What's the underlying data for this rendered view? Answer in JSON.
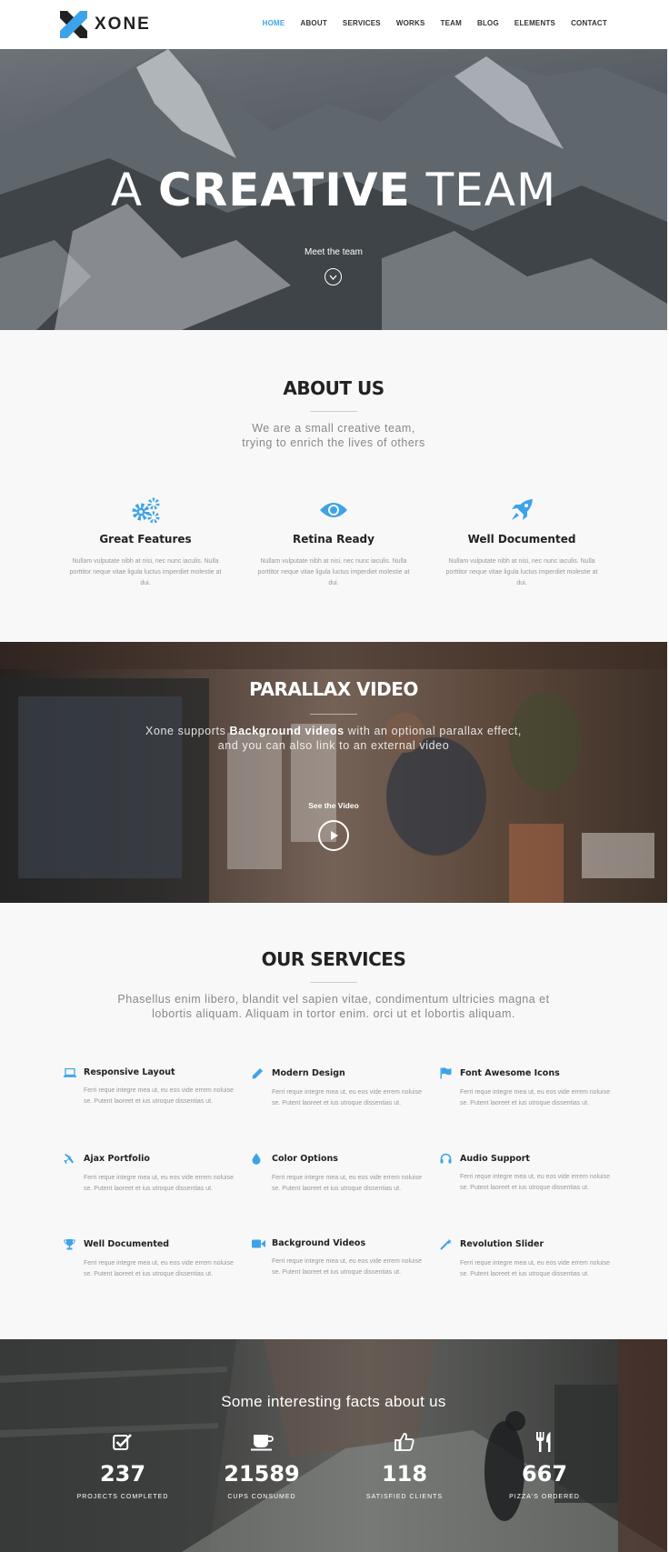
{
  "brand": {
    "name": "XONE",
    "accent": "#3da3e8"
  },
  "nav": {
    "items": [
      {
        "label": "HOME",
        "active": true
      },
      {
        "label": "ABOUT"
      },
      {
        "label": "SERVICES"
      },
      {
        "label": "WORKS"
      },
      {
        "label": "TEAM"
      },
      {
        "label": "BLOG"
      },
      {
        "label": "ELEMENTS"
      },
      {
        "label": "CONTACT"
      }
    ]
  },
  "hero": {
    "title_a": "A",
    "title_b": "CREATIVE",
    "title_c": "TEAM",
    "subtitle": "Meet the team",
    "scroll_icon": "chevron-down-icon"
  },
  "about": {
    "title": "ABOUT US",
    "lead_1": "We are a small creative team,",
    "lead_2": "trying to enrich the lives of others",
    "features": [
      {
        "icon": "gears-icon",
        "title": "Great Features",
        "text": "Nullam vulputate nibh at nisi, nec nunc iaculis. Nulla porttitor neque vitae ligula luctus imperdiet molestie at dui."
      },
      {
        "icon": "eye-icon",
        "title": "Retina Ready",
        "text": "Nullam vulputate nibh at nisi, nec nunc iaculis. Nulla porttitor neque vitae ligula luctus imperdiet molestie at dui."
      },
      {
        "icon": "rocket-icon",
        "title": "Well Documented",
        "text": "Nullam vulputate nibh at nisi, nec nunc iaculis. Nulla porttitor neque vitae ligula luctus imperdiet molestie at dui."
      }
    ]
  },
  "parallax": {
    "title": "PARALLAX VIDEO",
    "lead_pre": "Xone supports ",
    "lead_bold": "Background videos",
    "lead_post": " with an optional parallax effect,",
    "lead_2": "and you can also link to an external video",
    "see_label": "See the Video",
    "play_icon": "play-icon"
  },
  "services": {
    "title": "OUR SERVICES",
    "lead_1": "Phasellus enim libero, blandit vel sapien vitae, condimentum ultricies magna et",
    "lead_2": "lobortis aliquam. Aliquam in tortor enim. orci ut et lobortis aliquam.",
    "items": [
      {
        "icon": "laptop-icon",
        "title": "Responsive Layout",
        "text": "Ferri reque integre mea ut, eu eos vide errem noluise se. Putent laoreet et ius utroque dissentias ut."
      },
      {
        "icon": "pencil-icon",
        "title": "Modern Design",
        "text": "Ferri reque integre mea ut, eu eos vide errem noluise se. Putent laoreet et ius utroque dissentias ut."
      },
      {
        "icon": "flag-icon",
        "title": "Font Awesome Icons",
        "text": "Ferri reque integre mea ut, eu eos vide errem noluise se. Putent laoreet et ius utroque dissentias ut."
      },
      {
        "icon": "plane-icon",
        "title": "Ajax Portfolio",
        "text": "Ferri reque integre mea ut, eu eos vide errem noluise se. Putent laoreet et ius utroque dissentias ut."
      },
      {
        "icon": "drop-icon",
        "title": "Color Options",
        "text": "Ferri reque integre mea ut, eu eos vide errem noluise se. Putent laoreet et ius utroque dissentias ut."
      },
      {
        "icon": "headphones-icon",
        "title": "Audio Support",
        "text": "Ferri reque integre mea ut, eu eos vide errem noluise se. Putent laoreet et ius utroque dissentias ut."
      },
      {
        "icon": "trophy-icon",
        "title": "Well Documented",
        "text": "Ferri reque integre mea ut, eu eos vide errem noluise se. Putent laoreet et ius utroque dissentias ut."
      },
      {
        "icon": "video-camera-icon",
        "title": "Background Videos",
        "text": "Ferri reque integre mea ut, eu eos vide errem noluise se. Putent laoreet et ius utroque dissentias ut."
      },
      {
        "icon": "magic-wand-icon",
        "title": "Revolution Slider",
        "text": "Ferri reque integre mea ut, eu eos vide errem noluise se. Putent laoreet et ius utroque dissentias ut."
      }
    ]
  },
  "facts": {
    "title": "Some interesting facts about us",
    "items": [
      {
        "icon": "check-square-icon",
        "number": "237",
        "label": "PROJECTS COMPLETED"
      },
      {
        "icon": "coffee-cup-icon",
        "number": "21589",
        "label": "CUPS CONSUMED"
      },
      {
        "icon": "thumbs-up-icon",
        "number": "118",
        "label": "SATISFIED CLIENTS"
      },
      {
        "icon": "cutlery-icon",
        "number": "667",
        "label": "PIZZA'S ORDERED"
      }
    ]
  }
}
